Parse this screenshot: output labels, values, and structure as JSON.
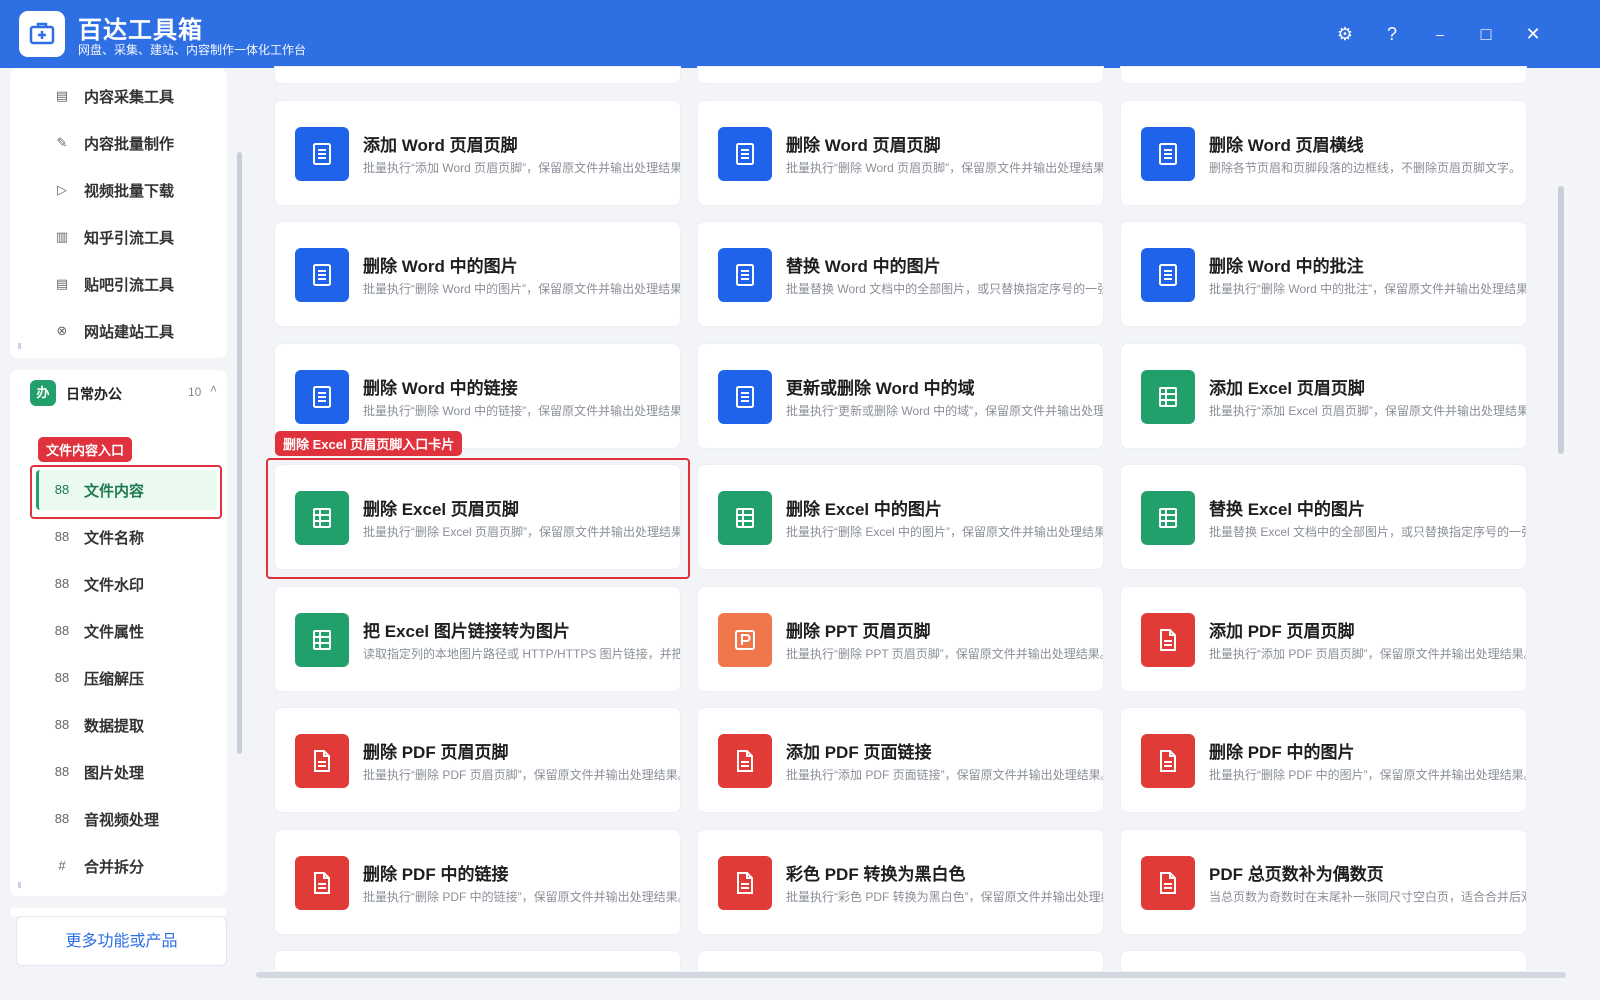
{
  "app": {
    "title": "百达工具箱",
    "subtitle": "网盘、采集、建站、内容制作一体化工作台"
  },
  "window_controls": {
    "settings": "⚙",
    "help": "?",
    "minimize": "–",
    "maximize": "□",
    "close": "✕"
  },
  "sidebar": {
    "top_items": [
      {
        "label": "内容采集工具",
        "icon": "▤"
      },
      {
        "label": "内容批量制作",
        "icon": "✎"
      },
      {
        "label": "视频批量下载",
        "icon": "▷"
      },
      {
        "label": "知乎引流工具",
        "icon": "▥"
      },
      {
        "label": "贴吧引流工具",
        "icon": "▤"
      },
      {
        "label": "网站建站工具",
        "icon": "⊗"
      }
    ],
    "group": {
      "badge": "办",
      "title": "日常办公",
      "count": "10",
      "caret": "˄"
    },
    "group_items": [
      {
        "label": "文件内容",
        "icon": "88"
      },
      {
        "label": "文件名称",
        "icon": "88"
      },
      {
        "label": "文件水印",
        "icon": "88"
      },
      {
        "label": "文件属性",
        "icon": "88"
      },
      {
        "label": "压缩解压",
        "icon": "88"
      },
      {
        "label": "数据提取",
        "icon": "88"
      },
      {
        "label": "图片处理",
        "icon": "88"
      },
      {
        "label": "音视频处理",
        "icon": "88"
      },
      {
        "label": "合并拆分",
        "icon": "#"
      }
    ],
    "highlight_tag": "文件内容入口",
    "more_button": "更多功能或产品"
  },
  "card_highlight_tag": "删除 Excel 页眉页脚入口卡片",
  "cards": [
    {
      "title": "添加 Word 页眉页脚",
      "desc": "批量执行“添加 Word 页眉页脚”，保留原文件并输出处理结果。",
      "color": "#1f63ea",
      "icon": "word-doc-icon"
    },
    {
      "title": "删除 Word 页眉页脚",
      "desc": "批量执行“删除 Word 页眉页脚”，保留原文件并输出处理结果。",
      "color": "#1f63ea",
      "icon": "word-doc-icon"
    },
    {
      "title": "删除 Word 页眉横线",
      "desc": "删除各节页眉和页脚段落的边框线，不删除页眉页脚文字。",
      "color": "#1f63ea",
      "icon": "word-doc-icon"
    },
    {
      "title": "删除 Word 中的图片",
      "desc": "批量执行“删除 Word 中的图片”，保留原文件并输出处理结果。",
      "color": "#1f63ea",
      "icon": "word-doc-icon"
    },
    {
      "title": "替换 Word 中的图片",
      "desc": "批量替换 Word 文档中的全部图片，或只替换指定序号的一张图片",
      "color": "#1f63ea",
      "icon": "word-doc-icon"
    },
    {
      "title": "删除 Word 中的批注",
      "desc": "批量执行“删除 Word 中的批注”，保留原文件并输出处理结果。",
      "color": "#1f63ea",
      "icon": "word-doc-icon"
    },
    {
      "title": "删除 Word 中的链接",
      "desc": "批量执行“删除 Word 中的链接”，保留原文件并输出处理结果。",
      "color": "#1f63ea",
      "icon": "word-doc-icon"
    },
    {
      "title": "更新或删除 Word 中的域",
      "desc": "批量执行“更新或删除 Word 中的域”，保留原文件并输出处理结果。",
      "color": "#1f63ea",
      "icon": "word-doc-icon"
    },
    {
      "title": "添加 Excel 页眉页脚",
      "desc": "批量执行“添加 Excel 页眉页脚”，保留原文件并输出处理结果。",
      "color": "#22a06b",
      "icon": "excel-sheet-icon"
    },
    {
      "title": "删除 Excel 页眉页脚",
      "desc": "批量执行“删除 Excel 页眉页脚”，保留原文件并输出处理结果。",
      "color": "#22a06b",
      "icon": "excel-sheet-icon"
    },
    {
      "title": "删除 Excel 中的图片",
      "desc": "批量执行“删除 Excel 中的图片”，保留原文件并输出处理结果。",
      "color": "#22a06b",
      "icon": "excel-sheet-icon"
    },
    {
      "title": "替换 Excel 中的图片",
      "desc": "批量替换 Excel 文档中的全部图片，或只替换指定序号的一张图片。",
      "color": "#22a06b",
      "icon": "excel-sheet-icon"
    },
    {
      "title": "把 Excel 图片链接转为图片",
      "desc": "读取指定列的本地图片路径或 HTTP/HTTPS 图片链接，并把图片",
      "color": "#22a06b",
      "icon": "excel-sheet-icon"
    },
    {
      "title": "删除 PPT 页眉页脚",
      "desc": "批量执行“删除 PPT 页眉页脚”，保留原文件并输出处理结果。",
      "color": "#f0774b",
      "icon": "ppt-slide-icon"
    },
    {
      "title": "添加 PDF 页眉页脚",
      "desc": "批量执行“添加 PDF 页眉页脚”，保留原文件并输出处理结果。",
      "color": "#e03b36",
      "icon": "pdf-file-icon"
    },
    {
      "title": "删除 PDF 页眉页脚",
      "desc": "批量执行“删除 PDF 页眉页脚”，保留原文件并输出处理结果。",
      "color": "#e03b36",
      "icon": "pdf-file-icon"
    },
    {
      "title": "添加 PDF 页面链接",
      "desc": "批量执行“添加 PDF 页面链接”，保留原文件并输出处理结果。",
      "color": "#e03b36",
      "icon": "pdf-file-icon"
    },
    {
      "title": "删除 PDF 中的图片",
      "desc": "批量执行“删除 PDF 中的图片”，保留原文件并输出处理结果。",
      "color": "#e03b36",
      "icon": "pdf-file-icon"
    },
    {
      "title": "删除 PDF 中的链接",
      "desc": "批量执行“删除 PDF 中的链接”，保留原文件并输出处理结果。",
      "color": "#e03b36",
      "icon": "pdf-file-icon"
    },
    {
      "title": "彩色 PDF 转换为黑白色",
      "desc": "批量执行“彩色 PDF 转换为黑白色”，保留原文件并输出处理结果。",
      "color": "#e03b36",
      "icon": "pdf-file-icon"
    },
    {
      "title": "PDF 总页数补为偶数页",
      "desc": "当总页数为奇数时在末尾补一张同尺寸空白页，适合合并后双面打印",
      "color": "#e03b36",
      "icon": "pdf-file-icon"
    }
  ]
}
